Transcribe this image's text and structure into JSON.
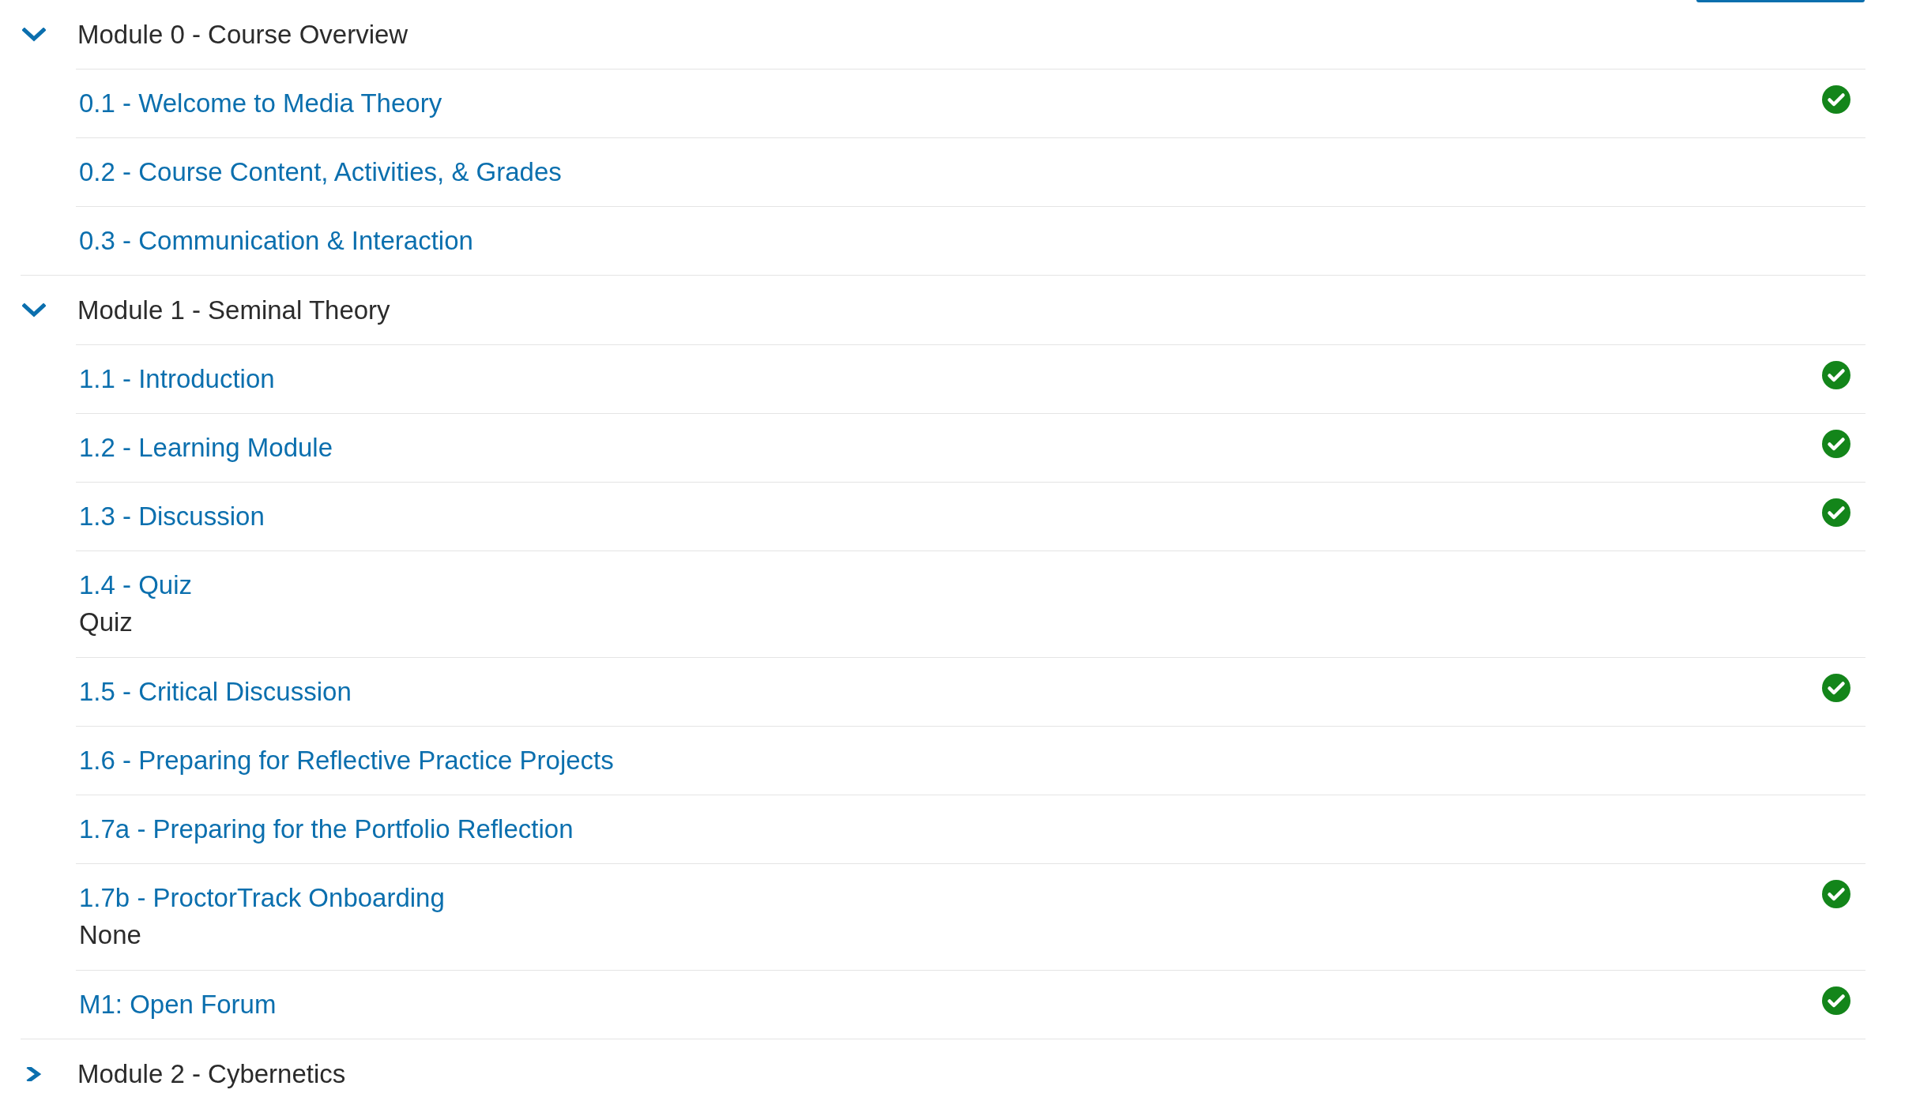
{
  "modules": [
    {
      "title": "Module 0 - Course Overview",
      "expanded": true,
      "items": [
        {
          "title": "0.1 - Welcome to Media Theory",
          "completed": true
        },
        {
          "title": "0.2 - Course Content, Activities, & Grades",
          "completed": false
        },
        {
          "title": "0.3 - Communication & Interaction",
          "completed": false
        }
      ]
    },
    {
      "title": "Module 1 - Seminal Theory",
      "expanded": true,
      "items": [
        {
          "title": "1.1 - Introduction",
          "completed": true
        },
        {
          "title": "1.2 - Learning Module",
          "completed": true
        },
        {
          "title": "1.3 - Discussion",
          "completed": true
        },
        {
          "title": "1.4 - Quiz",
          "subtitle": "Quiz",
          "completed": false
        },
        {
          "title": "1.5 - Critical Discussion",
          "completed": true
        },
        {
          "title": "1.6 - Preparing for Reflective Practice Projects",
          "completed": false
        },
        {
          "title": "1.7a - Preparing for the Portfolio Reflection",
          "completed": false
        },
        {
          "title": "1.7b - ProctorTrack Onboarding",
          "subtitle": "None",
          "completed": true
        },
        {
          "title": "M1: Open Forum",
          "completed": true
        }
      ]
    },
    {
      "title": "Module 2 - Cybernetics",
      "expanded": false
    }
  ]
}
